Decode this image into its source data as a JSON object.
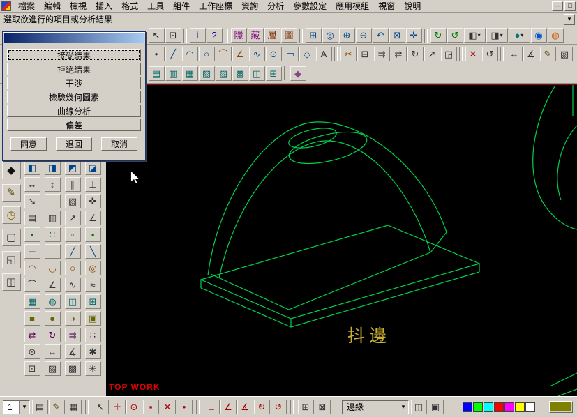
{
  "menu_bar": {
    "items": [
      {
        "name": "menu-file",
        "label": "檔案"
      },
      {
        "name": "menu-edit",
        "label": "編輯"
      },
      {
        "name": "menu-view",
        "label": "檢視"
      },
      {
        "name": "menu-insert",
        "label": "插入"
      },
      {
        "name": "menu-format",
        "label": "格式"
      },
      {
        "name": "menu-tools",
        "label": "工具"
      },
      {
        "name": "menu-components",
        "label": "組件"
      },
      {
        "name": "menu-wcs",
        "label": "工作座標"
      },
      {
        "name": "menu-inquiry",
        "label": "資詢"
      },
      {
        "name": "menu-analysis",
        "label": "分析"
      },
      {
        "name": "menu-parameters",
        "label": "參數設定"
      },
      {
        "name": "menu-applications",
        "label": "應用模組"
      },
      {
        "name": "menu-window",
        "label": "視窗"
      },
      {
        "name": "menu-help",
        "label": "說明"
      }
    ],
    "window_controls": {
      "minimize": "—",
      "restore": "□"
    }
  },
  "prompt_bar": {
    "text": "選取欲進行的項目或分析結果"
  },
  "dialog": {
    "options": [
      "接受結果",
      "拒絕結果",
      "干涉",
      "檢驗幾何圖素",
      "曲線分析",
      "偏差"
    ],
    "agree": "同意",
    "back": "退回",
    "cancel": "取消"
  },
  "toolbars": {
    "row1": [
      {
        "n": "select-arrow-icon",
        "g": "↖",
        "c": "#222222"
      },
      {
        "n": "window-select-icon",
        "g": "⊡",
        "c": "#222222"
      },
      {
        "sep": true
      },
      {
        "n": "info-icon",
        "g": "i",
        "c": "#000099"
      },
      {
        "n": "context-help-icon",
        "g": "?",
        "c": "#000099"
      },
      {
        "sep": true
      },
      {
        "n": "hide-entities-icon",
        "g": "隱",
        "c": "#800080"
      },
      {
        "n": "unhide-entities-icon",
        "g": "藏",
        "c": "#800080"
      },
      {
        "n": "level-display-icon",
        "g": "層",
        "c": "#803000"
      },
      {
        "n": "blank-entities-icon",
        "g": "圖",
        "c": "#803000"
      },
      {
        "sep": true
      },
      {
        "n": "zoom-window-icon",
        "g": "⊞",
        "c": "#004488"
      },
      {
        "n": "zoom-target-icon",
        "g": "◎",
        "c": "#004488"
      },
      {
        "n": "zoom-in-icon",
        "g": "⊕",
        "c": "#004488"
      },
      {
        "n": "zoom-out-icon",
        "g": "⊖",
        "c": "#004488"
      },
      {
        "n": "zoom-previous-icon",
        "g": "↶",
        "c": "#004488"
      },
      {
        "n": "fit-screen-icon",
        "g": "⊠",
        "c": "#004488"
      },
      {
        "n": "pan-icon",
        "g": "✛",
        "c": "#004488"
      },
      {
        "sep": true
      },
      {
        "n": "repaint-icon",
        "g": "↻",
        "c": "#007700"
      },
      {
        "n": "dynamic-rotate-icon",
        "g": "↺",
        "c": "#007700"
      },
      {
        "n": "gview-cube-icon",
        "g": "◧",
        "caret": true
      },
      {
        "n": "cplane-select-icon",
        "g": "◨",
        "caret": true
      },
      {
        "n": "shading-mode-icon",
        "g": "●",
        "c": "#007777",
        "caret": true
      },
      {
        "n": "render-globe-icon",
        "g": "◉",
        "c": "#0055cc"
      },
      {
        "n": "analysis-sphere-icon",
        "g": "◍",
        "c": "#cc5500"
      }
    ],
    "row2": [
      {
        "n": "create-point-icon",
        "g": "•"
      },
      {
        "n": "create-line-icon",
        "g": "╱",
        "c": "#004488"
      },
      {
        "n": "create-arc-icon",
        "g": "◠",
        "c": "#004488"
      },
      {
        "n": "create-circle-icon",
        "g": "○",
        "c": "#004488"
      },
      {
        "n": "create-fillet-icon",
        "g": "⌒",
        "c": "#884400"
      },
      {
        "n": "create-chamfer-icon",
        "g": "∠",
        "c": "#884400"
      },
      {
        "n": "create-spline-icon",
        "g": "∿",
        "c": "#004488"
      },
      {
        "n": "create-ellipse-icon",
        "g": "⊙",
        "c": "#004488"
      },
      {
        "n": "create-rectangle-icon",
        "g": "▭",
        "c": "#004488"
      },
      {
        "n": "create-polygon-icon",
        "g": "◇",
        "c": "#004488"
      },
      {
        "n": "create-letters-icon",
        "g": "A",
        "c": "#333333"
      },
      {
        "sep": true
      },
      {
        "n": "trim-entities-icon",
        "g": "✂",
        "c": "#884400"
      },
      {
        "n": "break-entities-icon",
        "g": "⊟"
      },
      {
        "n": "offset-entities-icon",
        "g": "⇉"
      },
      {
        "n": "mirror-entities-icon",
        "g": "⇄"
      },
      {
        "n": "xform-rotate-icon",
        "g": "↻"
      },
      {
        "n": "xform-translate-icon",
        "g": "↗"
      },
      {
        "n": "xform-scale-icon",
        "g": "◲"
      },
      {
        "sep": true
      },
      {
        "n": "delete-entities-icon",
        "g": "✕",
        "c": "#aa0000"
      },
      {
        "n": "undelete-icon",
        "g": "↺"
      },
      {
        "sep": true
      },
      {
        "n": "measure-distance-icon",
        "g": "↔"
      },
      {
        "n": "angle-measure-icon",
        "g": "∡"
      },
      {
        "n": "note-text-icon",
        "g": "✎",
        "c": "#554400"
      },
      {
        "n": "hatch-icon",
        "g": "▨"
      }
    ],
    "row3": [
      {
        "n": "ruled-surface-icon",
        "g": "▤",
        "c": "#006666"
      },
      {
        "n": "revolved-surface-icon",
        "g": "▥",
        "c": "#006666"
      },
      {
        "n": "swept-surface-icon",
        "g": "▦",
        "c": "#006666"
      },
      {
        "n": "net-surface-icon",
        "g": "▧",
        "c": "#006666"
      },
      {
        "n": "draft-surface-icon",
        "g": "▨",
        "c": "#006666"
      },
      {
        "n": "fillet-surface-icon",
        "g": "▩",
        "c": "#006666"
      },
      {
        "n": "offset-surface-icon",
        "g": "◫",
        "c": "#006666"
      },
      {
        "n": "trim-surface-icon",
        "g": "⊞",
        "c": "#006666"
      },
      {
        "sep": true
      },
      {
        "n": "primitives-icon",
        "g": "◆",
        "c": "#884488"
      }
    ],
    "left_big": [
      {
        "n": "mastercam-logo-icon",
        "g": "◆",
        "c": "#111111"
      },
      {
        "n": "sketcher-icon",
        "g": "✎",
        "c": "#554400"
      },
      {
        "n": "history-clock-icon",
        "g": "◷",
        "c": "#806000"
      },
      {
        "n": "sheet-icon",
        "g": "▢",
        "c": "#333333"
      },
      {
        "n": "viewport-window-icon",
        "g": "◱",
        "c": "#333333"
      },
      {
        "n": "layout-icon",
        "g": "◫",
        "c": "#333333"
      }
    ],
    "left_grid": [
      {
        "n": "view-front-icon",
        "g": "◧",
        "c": "#004488"
      },
      {
        "n": "view-side-icon",
        "g": "◨",
        "c": "#004488"
      },
      {
        "n": "view-top-icon",
        "g": "◩",
        "c": "#004488"
      },
      {
        "n": "view-isometric-icon",
        "g": "◪",
        "c": "#004488"
      },
      {
        "n": "dim-horizontal-icon",
        "g": "↔",
        "c": "#333333"
      },
      {
        "n": "dim-vertical-icon",
        "g": "↕",
        "c": "#333333"
      },
      {
        "n": "dim-parallel-icon",
        "g": "∥",
        "c": "#333333"
      },
      {
        "n": "dim-perpendicular-icon",
        "g": "⊥",
        "c": "#333333"
      },
      {
        "n": "leader-note-icon",
        "g": "↘"
      },
      {
        "n": "witness-line-icon",
        "g": "│"
      },
      {
        "n": "hatch-pattern-icon",
        "g": "▨"
      },
      {
        "n": "smart-dimension-icon",
        "g": "✜"
      },
      {
        "n": "draft-options-icon",
        "g": "▤"
      },
      {
        "n": "multi-edit-icon",
        "g": "▥"
      },
      {
        "n": "aligned-dim-icon",
        "g": "↗"
      },
      {
        "n": "angular-dim-icon",
        "g": "∠"
      },
      {
        "n": "point-position-icon",
        "g": "•",
        "c": "#007700"
      },
      {
        "n": "point-node-icon",
        "g": "∷",
        "c": "#007700"
      },
      {
        "n": "point-segment-icon",
        "g": "◦",
        "c": "#007700"
      },
      {
        "n": "point-endpoint-icon",
        "g": "▪",
        "c": "#007700"
      },
      {
        "n": "line-horizontal-icon",
        "g": "─",
        "c": "#004488"
      },
      {
        "n": "line-vertical-icon",
        "g": "│",
        "c": "#004488"
      },
      {
        "n": "line-polar-icon",
        "g": "╱",
        "c": "#004488"
      },
      {
        "n": "line-tangent-icon",
        "g": "╲",
        "c": "#004488"
      },
      {
        "n": "arc-center-icon",
        "g": "◠",
        "c": "#884400"
      },
      {
        "n": "arc-endpoints-icon",
        "g": "◡",
        "c": "#884400"
      },
      {
        "n": "circle-points-icon",
        "g": "○",
        "c": "#884400"
      },
      {
        "n": "circle-tangent-icon",
        "g": "◎",
        "c": "#884400"
      },
      {
        "n": "fillet-radius-icon",
        "g": "⌒"
      },
      {
        "n": "chamfer-distance-icon",
        "g": "∠"
      },
      {
        "n": "spline-manual-icon",
        "g": "∿"
      },
      {
        "n": "curve-blend-icon",
        "g": "≈"
      },
      {
        "n": "surface-ruled2-icon",
        "g": "▦",
        "c": "#006666"
      },
      {
        "n": "surface-revolved2-icon",
        "g": "◍",
        "c": "#006666"
      },
      {
        "n": "surface-offset2-icon",
        "g": "◫",
        "c": "#006666"
      },
      {
        "n": "surface-trim2-icon",
        "g": "⊞",
        "c": "#006666"
      },
      {
        "n": "solid-extrude-icon",
        "g": "■",
        "c": "#666600"
      },
      {
        "n": "solid-revolve-icon",
        "g": "●",
        "c": "#666600"
      },
      {
        "n": "solid-sweep-icon",
        "g": "◑",
        "c": "#666600"
      },
      {
        "n": "solid-loft-icon",
        "g": "▣",
        "c": "#666600"
      },
      {
        "n": "xform-mirror2-icon",
        "g": "⇄",
        "c": "#550055"
      },
      {
        "n": "xform-rotate2-icon",
        "g": "↻",
        "c": "#550055"
      },
      {
        "n": "xform-offset2-icon",
        "g": "⇉",
        "c": "#550055"
      },
      {
        "n": "xform-array-icon",
        "g": "∷",
        "c": "#550055"
      },
      {
        "n": "analyze-position-icon",
        "g": "⊙"
      },
      {
        "n": "analyze-distance-icon",
        "g": "↔"
      },
      {
        "n": "analyze-angle-icon",
        "g": "∡"
      },
      {
        "n": "analyze-dynamic-icon",
        "g": "✱"
      },
      {
        "n": "screen-statistics-icon",
        "g": "⊡"
      },
      {
        "n": "screen-colors-icon",
        "g": "▧"
      },
      {
        "n": "screen-groups-icon",
        "g": "▩"
      },
      {
        "n": "screen-configure-icon",
        "g": "✳"
      }
    ]
  },
  "viewport": {
    "annotation": "抖邊",
    "view_label": "TOP WORK",
    "background": "#000000",
    "wire_color": "#00d24b",
    "annotation_color": "#c8b032",
    "view_label_color": "#e00000",
    "border_color": "#8b0000"
  },
  "status_bar": {
    "level_value": "1",
    "edge_value": "邊緣",
    "group_a": [
      {
        "n": "level-manager-icon",
        "g": "▤"
      },
      {
        "n": "attribute-pencil-icon",
        "g": "✎",
        "c": "#554400"
      },
      {
        "n": "group-manager-icon",
        "g": "▦"
      }
    ],
    "group_b": [
      {
        "n": "autocursor-icon",
        "g": "↖",
        "c": "#333333"
      },
      {
        "n": "snap-origin-icon",
        "g": "✛",
        "c": "#aa0000"
      },
      {
        "n": "snap-center-icon",
        "g": "⊙",
        "c": "#aa0000"
      },
      {
        "n": "snap-endpoint-icon",
        "g": "▪",
        "c": "#aa0000"
      },
      {
        "n": "snap-intersection-icon",
        "g": "✕",
        "c": "#aa0000"
      },
      {
        "n": "snap-midpoint-icon",
        "g": "•",
        "c": "#aa0000"
      }
    ],
    "group_c": [
      {
        "n": "gview-top-icon",
        "g": "∟",
        "c": "#aa0000"
      },
      {
        "n": "gview-front-icon",
        "g": "∠",
        "c": "#aa0000"
      },
      {
        "n": "gview-side-icon",
        "g": "∡",
        "c": "#aa0000"
      },
      {
        "n": "gview-rotate-icon",
        "g": "↻",
        "c": "#aa0000"
      },
      {
        "n": "gview-dynamic-icon",
        "g": "↺",
        "c": "#aa0000"
      }
    ],
    "group_d": [
      {
        "n": "cplane-icon",
        "g": "⊞"
      },
      {
        "n": "wcs-gnomon-icon",
        "g": "⊠"
      }
    ],
    "group_e": [
      {
        "n": "edge-settings-icon",
        "g": "◫"
      },
      {
        "n": "shading-toggle-icon",
        "g": "▣"
      }
    ],
    "palette": [
      "#0000ff",
      "#00ff00",
      "#00ffff",
      "#ff0000",
      "#ff00ff",
      "#ffff00",
      "#ffffff"
    ],
    "current_color": "#808000"
  }
}
